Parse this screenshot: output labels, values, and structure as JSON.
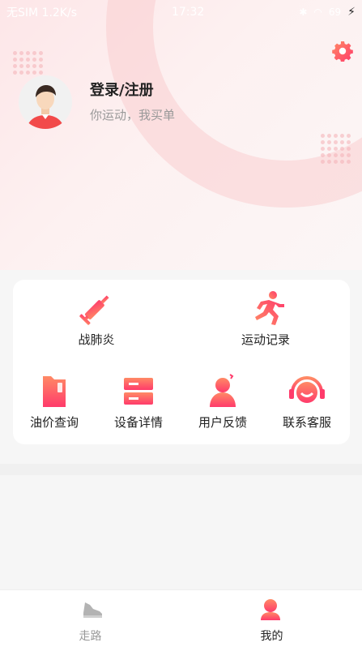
{
  "status_bar": {
    "carrier": "无SIM 1.2K/s",
    "time": "17:32",
    "battery": "69"
  },
  "profile": {
    "title": "登录/注册",
    "subtitle": "你运动，我买单"
  },
  "tools": [
    {
      "label": "战肺炎",
      "icon": "syringe-icon"
    },
    {
      "label": "运动记录",
      "icon": "running-icon"
    },
    {
      "label": "油价查询",
      "icon": "fuel-can-icon"
    },
    {
      "label": "设备详情",
      "icon": "server-icon"
    },
    {
      "label": "用户反馈",
      "icon": "feedback-user-icon"
    },
    {
      "label": "联系客服",
      "icon": "headset-icon"
    }
  ],
  "tabs": [
    {
      "label": "走路",
      "icon": "shoe-icon",
      "active": false
    },
    {
      "label": "我的",
      "icon": "person-icon",
      "active": true
    }
  ],
  "colors": {
    "accent_start": "#ff8a65",
    "accent_end": "#ff3b6b",
    "active_tab": "#222222",
    "inactive_tab": "#999999"
  }
}
